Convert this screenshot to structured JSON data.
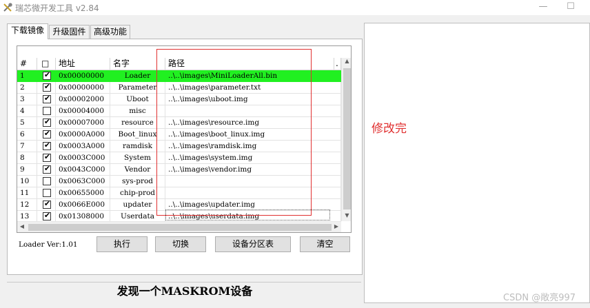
{
  "window": {
    "title": "瑞芯微开发工具 v2.84",
    "minimize_glyph": "—",
    "maximize_glyph": "☐"
  },
  "tabs": [
    {
      "label": "下载镜像",
      "active": true
    },
    {
      "label": "升级固件",
      "active": false
    },
    {
      "label": "高级功能",
      "active": false
    }
  ],
  "grid": {
    "headers": [
      "#",
      "□",
      "地址",
      "名字",
      "路径",
      "."
    ],
    "rows": [
      {
        "num": "1",
        "checked": true,
        "addr": "0x00000000",
        "name": "Loader",
        "path": "..\\..\\images\\MiniLoaderAll.bin",
        "highlight": true
      },
      {
        "num": "2",
        "checked": true,
        "addr": "0x00000000",
        "name": "Parameter",
        "path": "..\\..\\images\\parameter.txt"
      },
      {
        "num": "3",
        "checked": true,
        "addr": "0x00002000",
        "name": "Uboot",
        "path": "..\\..\\images\\uboot.img"
      },
      {
        "num": "4",
        "checked": false,
        "addr": "0x00004000",
        "name": "misc",
        "path": ""
      },
      {
        "num": "5",
        "checked": true,
        "addr": "0x00007000",
        "name": "resource",
        "path": "..\\..\\images\\resource.img"
      },
      {
        "num": "6",
        "checked": true,
        "addr": "0x0000A000",
        "name": "Boot_linux",
        "path": "..\\..\\images\\boot_linux.img"
      },
      {
        "num": "7",
        "checked": true,
        "addr": "0x0003A000",
        "name": "ramdisk",
        "path": "..\\..\\images\\ramdisk.img"
      },
      {
        "num": "8",
        "checked": true,
        "addr": "0x0003C000",
        "name": "System",
        "path": "..\\..\\images\\system.img"
      },
      {
        "num": "9",
        "checked": true,
        "addr": "0x0043C000",
        "name": "Vendor",
        "path": "..\\..\\images\\vendor.img"
      },
      {
        "num": "10",
        "checked": false,
        "addr": "0x0063C000",
        "name": "sys-prod",
        "path": ""
      },
      {
        "num": "11",
        "checked": false,
        "addr": "0x00655000",
        "name": "chip-prod",
        "path": ""
      },
      {
        "num": "12",
        "checked": true,
        "addr": "0x0066E000",
        "name": "updater",
        "path": "..\\..\\images\\updater.img"
      },
      {
        "num": "13",
        "checked": true,
        "addr": "0x01308000",
        "name": "Userdata",
        "path": "..\\..\\images\\userdata.img"
      }
    ],
    "highlight_color": "#21f021"
  },
  "loader_version": "Loader Ver:1.01",
  "buttons": {
    "run": "执行",
    "switch": "切换",
    "partition_table": "设备分区表",
    "clear": "清空"
  },
  "status": "发现一个MASKROM设备",
  "annotation": {
    "text": "修改完",
    "color": "#e03030"
  },
  "watermark": "CSDN @敞亮997",
  "icons": {
    "app": "tools-icon",
    "check": "✔"
  }
}
